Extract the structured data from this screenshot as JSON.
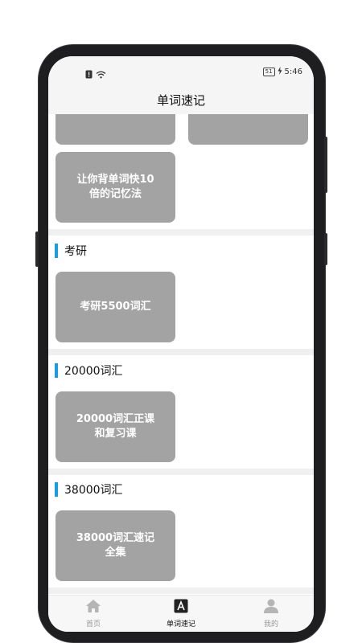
{
  "status_bar": {
    "time": "5:46",
    "battery": "51"
  },
  "header": {
    "title": "单词速记"
  },
  "top_cards": [
    {
      "label": ""
    },
    {
      "label": ""
    },
    {
      "label": "让你背单词快10\n倍的记忆法"
    }
  ],
  "sections": [
    {
      "title": "考研",
      "cards": [
        {
          "label": "考研5500词汇"
        }
      ]
    },
    {
      "title": "20000词汇",
      "cards": [
        {
          "label": "20000词汇正课\n和复习课"
        }
      ]
    },
    {
      "title": "38000词汇",
      "cards": [
        {
          "label": "38000词汇速记\n全集"
        }
      ]
    }
  ],
  "tabs": [
    {
      "label": "首页",
      "icon": "home-icon"
    },
    {
      "label": "单词速记",
      "icon": "letter-a-icon"
    },
    {
      "label": "我的",
      "icon": "person-icon"
    }
  ],
  "colors": {
    "accent": "#1a9be6",
    "card": "#a3a3a3",
    "frame": "#1e1e21"
  }
}
